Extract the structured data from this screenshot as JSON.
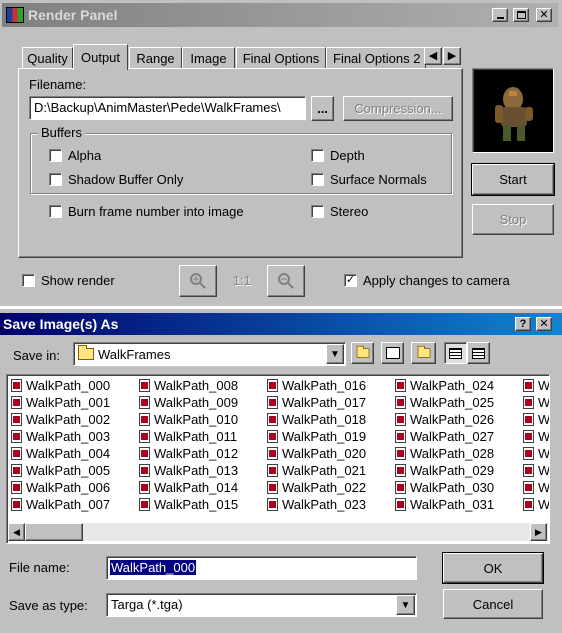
{
  "render_panel": {
    "title": "Render Panel",
    "tabs": [
      "Quality",
      "Output",
      "Range",
      "Image",
      "Final Options",
      "Final Options 2"
    ],
    "active_tab": "Output",
    "filename_label": "Filename:",
    "filename_value": "D:\\Backup\\AnimMaster\\Pede\\WalkFrames\\",
    "browse_label": "...",
    "compression_label": "Compression...",
    "buffers_label": "Buffers",
    "buffers": {
      "alpha": "Alpha",
      "depth": "Depth",
      "shadow_buffer_only": "Shadow Buffer Only",
      "surface_normals": "Surface Normals"
    },
    "burn_frame_label": "Burn frame number into image",
    "stereo_label": "Stereo",
    "show_render_label": "Show render",
    "zoom_ratio": "1:1",
    "apply_changes_label": "Apply changes to camera",
    "apply_changes_checked": true,
    "start_label": "Start",
    "stop_label": "Stop"
  },
  "save_dialog": {
    "title": "Save Image(s) As",
    "save_in_label": "Save in:",
    "save_in_value": "WalkFrames",
    "files": [
      [
        "WalkPath_000",
        "WalkPath_001",
        "WalkPath_002",
        "WalkPath_003",
        "WalkPath_004",
        "WalkPath_005",
        "WalkPath_006",
        "WalkPath_007"
      ],
      [
        "WalkPath_008",
        "WalkPath_009",
        "WalkPath_010",
        "WalkPath_011",
        "WalkPath_012",
        "WalkPath_013",
        "WalkPath_014",
        "WalkPath_015"
      ],
      [
        "WalkPath_016",
        "WalkPath_017",
        "WalkPath_018",
        "WalkPath_019",
        "WalkPath_020",
        "WalkPath_021",
        "WalkPath_022",
        "WalkPath_023"
      ],
      [
        "WalkPath_024",
        "WalkPath_025",
        "WalkPath_026",
        "WalkPath_027",
        "WalkPath_028",
        "WalkPath_029",
        "WalkPath_030",
        "WalkPath_031"
      ],
      [
        "W",
        "W",
        "W",
        "W",
        "W",
        "W",
        "W",
        "W"
      ]
    ],
    "file_name_label": "File name:",
    "file_name_value": "WalkPath_000",
    "save_as_type_label": "Save as type:",
    "save_as_type_value": "Targa (*.tga)",
    "ok_label": "OK",
    "cancel_label": "Cancel"
  },
  "colors": {
    "inactive_title": "#808080",
    "active_title_start": "#00006a",
    "active_title_end": "#1084d0",
    "selection": "#000080",
    "face": "#c0c0c0"
  }
}
